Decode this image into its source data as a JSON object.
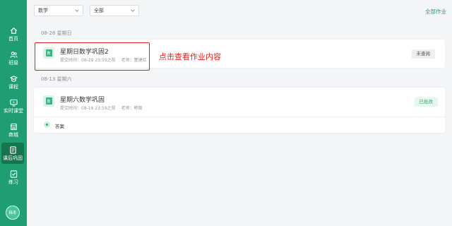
{
  "sidebar": {
    "items": [
      {
        "label": "首页",
        "icon": "home-icon"
      },
      {
        "label": "班级",
        "icon": "class-icon"
      },
      {
        "label": "课程",
        "icon": "course-icon"
      },
      {
        "label": "实时课堂",
        "icon": "live-class-icon"
      },
      {
        "label": "商城",
        "icon": "store-icon"
      },
      {
        "label": "课后巩固",
        "icon": "homework-icon",
        "active": true
      },
      {
        "label": "练习",
        "icon": "practice-icon"
      }
    ],
    "avatar_text": "韩冬"
  },
  "filters": {
    "subject": "数学",
    "status": "全部",
    "all_link": "全部作业"
  },
  "groups": [
    {
      "date": "08-28 星期日",
      "items": [
        {
          "title": "星期日数学巩固2",
          "submit_time": "提交时间：08-29 23:59之前",
          "teacher": "老师：董建红",
          "status": "未查阅",
          "subject_glyph": "数"
        }
      ]
    },
    {
      "date": "08-13 星期六",
      "items": [
        {
          "title": "星期六数学巩固",
          "submit_time": "提交时间：08-16 23:59之前",
          "teacher": "老师：韩敬",
          "status": "已批改",
          "subject_glyph": "数",
          "answer_label": "答案"
        }
      ]
    }
  ],
  "annotation": "点击查看作业内容",
  "colors": {
    "brand": "#1f9d73",
    "sidebar_active": "#14754f",
    "annotation": "#e02020",
    "done_text": "#2ab06f"
  }
}
